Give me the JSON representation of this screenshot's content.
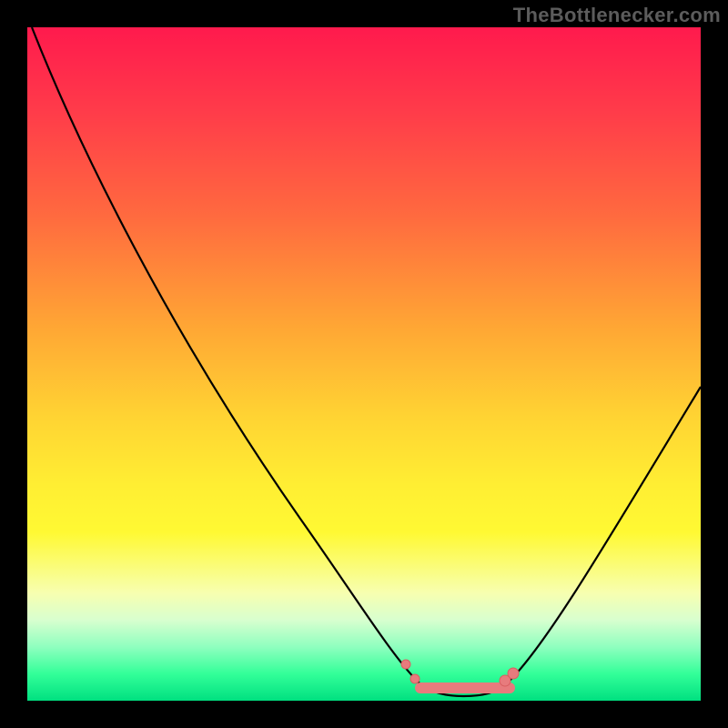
{
  "watermark": "TheBottlenecker.com",
  "colors": {
    "page_bg": "#000000",
    "gradient_top": "#ff1a4d",
    "gradient_bottom": "#00e080",
    "curve": "#000000",
    "highlight": "#e77b7d"
  },
  "chart_data": {
    "type": "line",
    "title": "",
    "xlabel": "",
    "ylabel": "",
    "xlim": [
      0,
      100
    ],
    "ylim": [
      0,
      100
    ],
    "grid": false,
    "legend": false,
    "series": [
      {
        "name": "bottleneck_curve",
        "x": [
          0,
          5,
          10,
          15,
          20,
          25,
          30,
          35,
          40,
          45,
          50,
          55,
          58,
          60,
          62,
          65,
          68,
          70,
          75,
          80,
          85,
          90,
          95,
          100
        ],
        "y": [
          100,
          93,
          85,
          77,
          70,
          61,
          53,
          45,
          37,
          29,
          20,
          10,
          4,
          2,
          1,
          1,
          1,
          2,
          4,
          9,
          17,
          26,
          36,
          47
        ]
      }
    ],
    "highlight_band": {
      "x_start": 58,
      "x_end": 72,
      "y": 1.5
    },
    "highlight_points": [
      {
        "x": 56,
        "y": 6,
        "r": 4
      },
      {
        "x": 58,
        "y": 3,
        "r": 4
      },
      {
        "x": 71,
        "y": 3,
        "r": 5
      },
      {
        "x": 72,
        "y": 4,
        "r": 5
      }
    ]
  }
}
